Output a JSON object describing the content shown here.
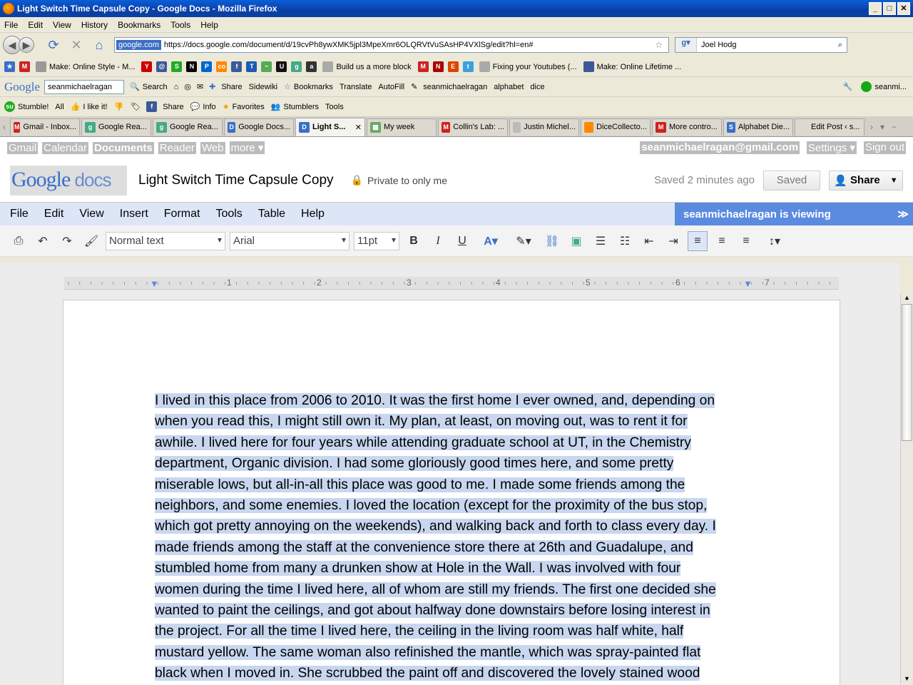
{
  "window": {
    "title": "Light Switch Time Capsule Copy - Google Docs - Mozilla Firefox"
  },
  "menu": [
    "File",
    "Edit",
    "View",
    "History",
    "Bookmarks",
    "Tools",
    "Help"
  ],
  "nav": {
    "site": "google.com",
    "url": "https://docs.google.com/document/d/19cvPh8ywXMK5jpl3MpeXmr6OLQRVtVuSAsHP4VXlSg/edit?hl=en#",
    "search": "Joel Hodg"
  },
  "bookmarks": [
    "Make: Online Style - M...",
    "Build us a more block",
    "Fixing your Youtubes (...",
    "Make: Online Lifetime ..."
  ],
  "google_toolbar": {
    "logo": "Google",
    "account": "seanmichaelragan",
    "items": [
      "Search",
      "Share",
      "Sidewiki",
      "Bookmarks",
      "Translate",
      "AutoFill",
      "seanmichaelragan",
      "alphabet",
      "dice",
      "seanmi..."
    ]
  },
  "stumble": {
    "items": [
      "Stumble!",
      "All",
      "I like it!",
      "Share",
      "Info",
      "Favorites",
      "Stumblers",
      "Tools"
    ]
  },
  "tabs": [
    "Gmail - Inbox...",
    "Google Rea...",
    "Google Rea...",
    "Google Docs...",
    "Light S...",
    "My week",
    "Collin's Lab: ...",
    "Justin Michel...",
    "DiceCollecto...",
    "More contro...",
    "Alphabet Die...",
    "Edit Post ‹ s..."
  ],
  "gbar": {
    "links": [
      "Gmail",
      "Calendar",
      "Documents",
      "Reader",
      "Web",
      "more ▾"
    ],
    "email": "seanmichaelragan@gmail.com",
    "settings": "Settings ▾",
    "signout": "Sign out"
  },
  "doc": {
    "logo_google": "Google",
    "logo_docs": " docs",
    "title": "Light Switch Time Capsule Copy",
    "privacy": "Private to only me",
    "saved_status": "Saved 2 minutes ago",
    "saved_btn": "Saved",
    "share_btn": "Share"
  },
  "docmenu": [
    "File",
    "Edit",
    "View",
    "Insert",
    "Format",
    "Tools",
    "Table",
    "Help"
  ],
  "viewing": "seanmichaelragan is viewing",
  "format": {
    "style": "Normal text",
    "font": "Arial",
    "size": "11pt"
  },
  "ruler_numbers": [
    "1",
    "2",
    "3",
    "4",
    "5",
    "6",
    "7"
  ],
  "body_lines": [
    "I lived in this place from 2006 to 2010.  It was the first home I ever owned, and, depending on",
    "when you read this, I might still own it.  My plan, at least, on moving out, was to rent it for",
    "awhile.  I lived here for four years while attending graduate school at UT, in the Chemistry",
    "department, Organic division.  I had some gloriously good times here, and some pretty",
    "miserable lows, but all-in-all this place was good to me. I made some friends among the",
    "neighbors, and some enemies.  I loved the location (except for the proximity of the bus stop,",
    "which got pretty annoying on the weekends), and walking back and forth to class every day.  I",
    "made friends among the staff at the convenience store there at 26th and Guadalupe, and",
    "stumbled home from many a drunken show at Hole in the Wall.    I was involved with four",
    "women during the time I lived here, all of whom are still my friends.  The first one decided she",
    "wanted to paint the ceilings, and got about halfway done downstairs before losing interest in",
    "the project.  For all the time I lived here, the ceiling in the living room was half white, half",
    "mustard yellow.  The same woman also refinished the mantle, which was spray-painted flat",
    "black when I moved in.  She scrubbed the paint off and discovered the lovely stained wood"
  ]
}
